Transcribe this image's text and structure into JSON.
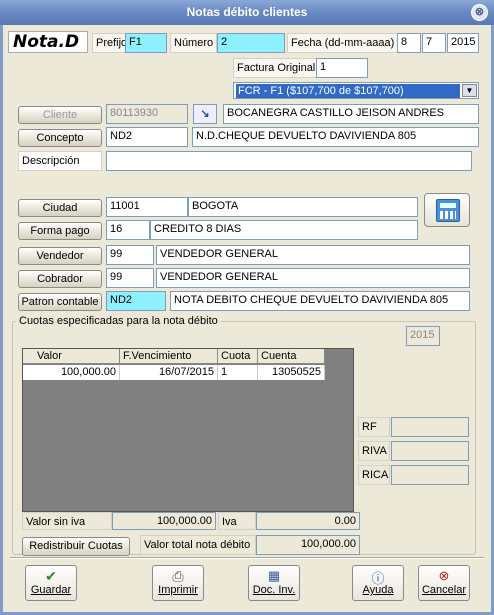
{
  "window": {
    "title": "Notas débito clientes",
    "close_symbol": "⊗"
  },
  "header": {
    "logo": "Nota.D",
    "prefijo_label": "Prefijo",
    "prefijo_value": "F1",
    "numero_label": "Número",
    "numero_value": "2",
    "fecha_label": "Fecha (dd-mm-aaaa)",
    "fecha_day": "8",
    "fecha_month": "7",
    "fecha_year": "2015",
    "factura_label": "Factura Original",
    "factura_value": "1",
    "factura_select": "FCR - F1 ($107,700 de $107,700)"
  },
  "form": {
    "cliente_btn": "Cliente",
    "cliente_code": "80113930",
    "cliente_name": "BOCANEGRA CASTILLO JEISON ANDRES",
    "concepto_btn": "Concepto",
    "concepto_code": "ND2",
    "concepto_name": "N.D.CHEQUE DEVUELTO DAVIVIENDA 805",
    "descripcion_label": "Descripción",
    "descripcion_value": "",
    "ciudad_btn": "Ciudad",
    "ciudad_code": "11001",
    "ciudad_name": "BOGOTA",
    "formapago_btn": "Forma pago",
    "formapago_code": "16",
    "formapago_name": "CREDITO 8 DIAS",
    "vendedor_btn": "Vendedor",
    "vendedor_code": "99",
    "vendedor_name": "VENDEDOR GENERAL",
    "cobrador_btn": "Cobrador",
    "cobrador_code": "99",
    "cobrador_name": "VENDEDOR GENERAL",
    "patron_btn": "Patron contable",
    "patron_code": "ND2",
    "patron_name": "NOTA DEBITO CHEQUE DEVUELTO DAVIVIENDA 805"
  },
  "cuotas": {
    "group_label": "Cuotas especificadas para la nota débito",
    "year": "2015",
    "columns": [
      "Valor",
      "F.Vencimiento",
      "Cuota",
      "Cuenta"
    ],
    "rows": [
      [
        "100,000.00",
        "16/07/2015",
        "1",
        "13050525"
      ]
    ],
    "rf_label": "RF",
    "riva_label": "RIVA",
    "rica_label": "RICA",
    "sin_iva_label": "Valor sin iva",
    "sin_iva_value": "100,000.00",
    "iva_label": "Iva",
    "iva_value": "0.00",
    "redistribuir_btn": "Redistribuir Cuotas",
    "total_label": "Valor total nota débito",
    "total_value": "100,000.00"
  },
  "toolbar": {
    "guardar": "Guardar",
    "imprimir": "Imprimir",
    "docinv": "Doc. Inv.",
    "ayuda": "Ayuda",
    "cancelar": "Cancelar"
  }
}
